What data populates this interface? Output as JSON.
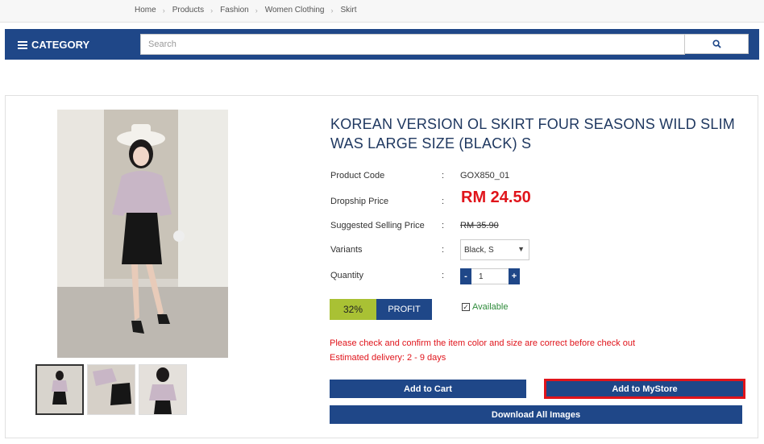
{
  "breadcrumb": [
    "Home",
    "Products",
    "Fashion",
    "Women Clothing",
    "Skirt"
  ],
  "navbar": {
    "category_label": "CATEGORY",
    "search_placeholder": "Search",
    "search_icon": "magnifier-icon",
    "brand_color": "#1f4788"
  },
  "product": {
    "title": "KOREAN VERSION OL SKIRT FOUR SEASONS WILD SLIM WAS LARGE SIZE (BLACK) S",
    "code_label": "Product Code",
    "code_value": "GOX850_01",
    "dropship_label": "Dropship Price",
    "dropship_value": "RM 24.50",
    "suggested_label": "Suggested Selling Price",
    "suggested_value": "RM 35.90",
    "variants_label": "Variants",
    "variant_selected": "Black, S",
    "quantity_label": "Quantity",
    "quantity_value": "1",
    "minus_label": "-",
    "plus_label": "+",
    "profit_percent": "32%",
    "profit_label": "PROFIT",
    "availability": "Available",
    "warning": "Please check and confirm the item color and size are correct before check out",
    "delivery": "Estimated delivery: 2 - 9 days",
    "price_color": "#e0141b",
    "profit_color": "#a9c134"
  },
  "actions": {
    "add_to_cart": "Add to Cart",
    "add_to_mystore": "Add to MyStore",
    "download_images": "Download All Images"
  },
  "colon": ":"
}
